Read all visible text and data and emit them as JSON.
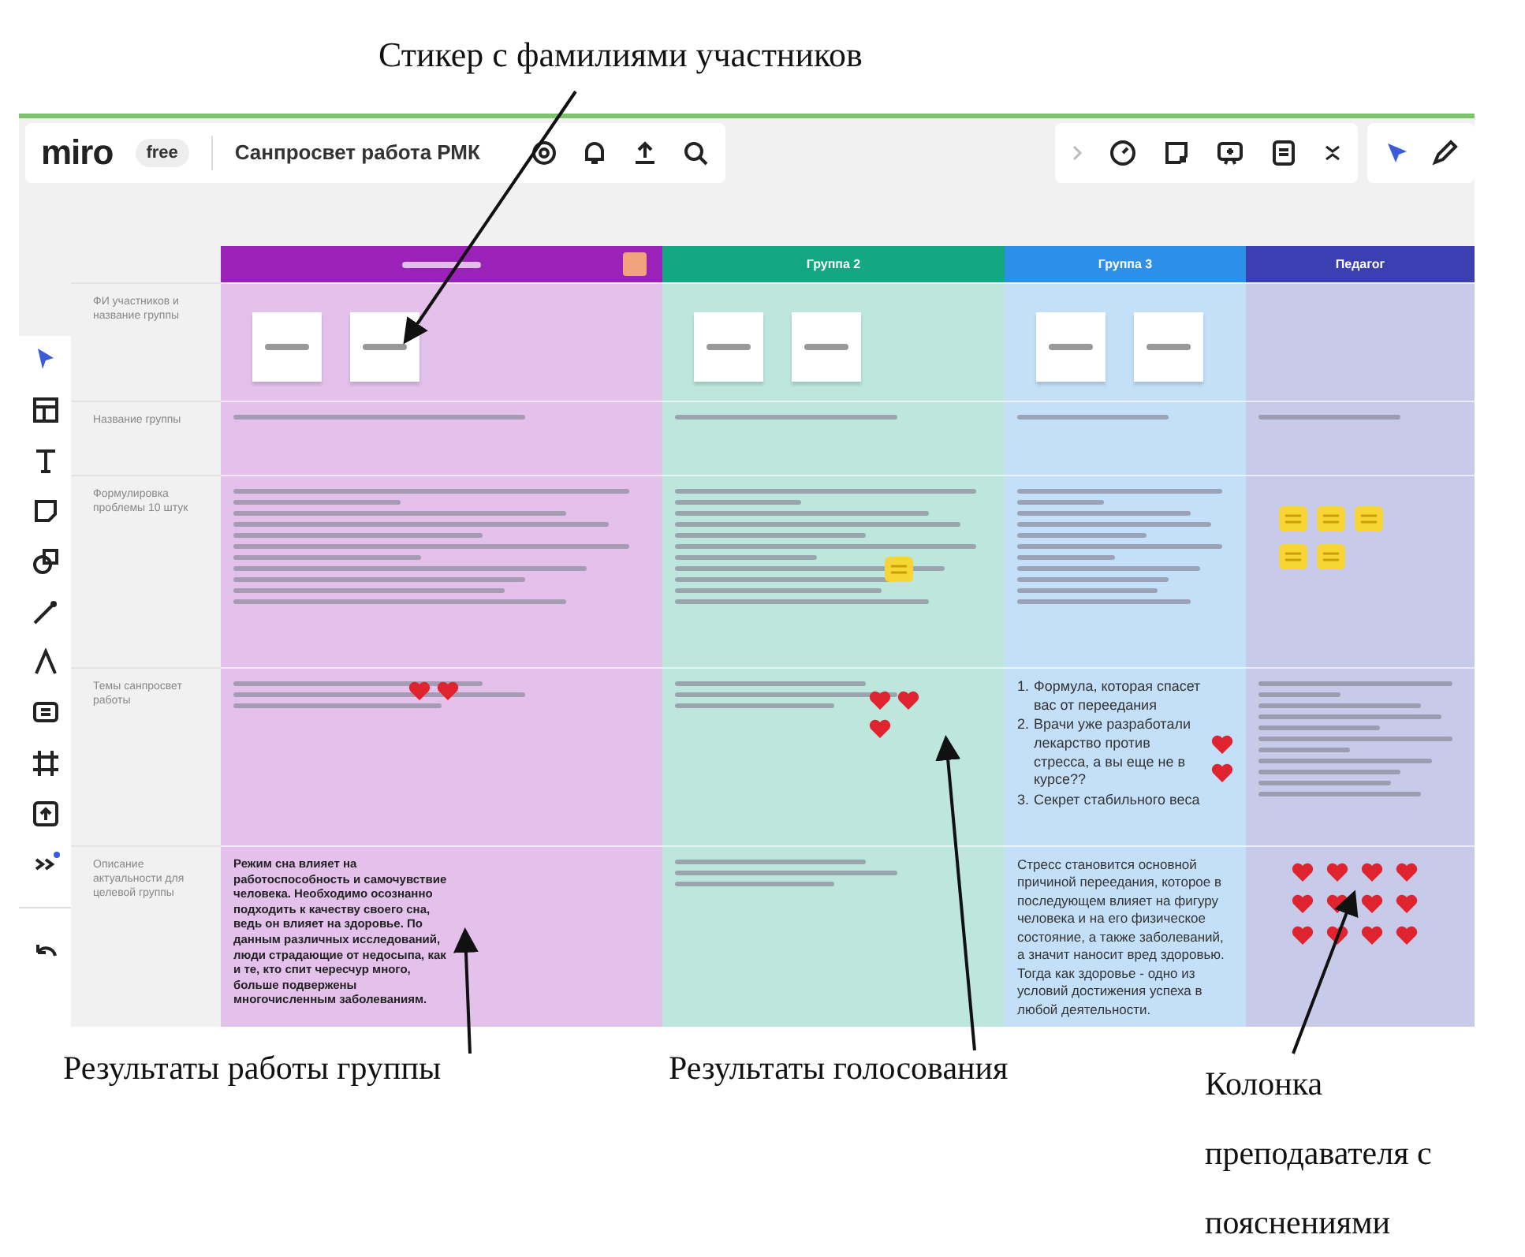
{
  "top_callout": "Стикер с фамилиями участников",
  "bottom_callouts": [
    "Результаты работы группы",
    "Результаты голосования",
    "Колонка преподавателя с пояснениями"
  ],
  "app": {
    "logo": "miro",
    "plan": "free",
    "board_title": "Санпросвет работа РМК"
  },
  "board": {
    "row_labels": [
      "ФИ участников и название группы",
      "Название группы",
      "Формулировка проблемы 10 штук",
      "Темы санпросвет работы",
      "Описание актуальности для целевой группы"
    ],
    "columns": [
      {
        "color": "#9b22b8",
        "cells": [
          {
            "kind": "stickers",
            "stickers": [
              {
                "kind": "note"
              },
              {
                "kind": "note"
              }
            ]
          },
          {
            "kind": "short"
          },
          {
            "kind": "long"
          },
          {
            "kind": "few",
            "reactions": [
              {
                "kind": "heart"
              },
              {
                "kind": "heart"
              }
            ]
          },
          {
            "kind": "paragraph",
            "text": "Режим сна влияет на работоспособность и самочувствие человека. Необходимо осознанно подходить к качеству своего сна, ведь он влияет на здоровье. По данным различных исследований, люди страдающие от недосыпа, как и те, кто спит чересчур много, больше подвержены многочисленным заболеваниям."
          }
        ]
      },
      {
        "title": "Группа 2",
        "color": "#14a882",
        "cells": [
          {
            "kind": "stickers",
            "stickers": [
              {
                "kind": "note"
              },
              {
                "kind": "note"
              }
            ]
          },
          {
            "kind": "short"
          },
          {
            "kind": "long",
            "reactions": [
              {
                "kind": "sticky"
              }
            ]
          },
          {
            "kind": "few",
            "reactions": [
              {
                "kind": "heart"
              },
              {
                "kind": "heart"
              },
              {
                "kind": "heart"
              }
            ]
          },
          {
            "kind": "few"
          }
        ]
      },
      {
        "title": "Группа 3",
        "color": "#2c8fe8",
        "cells": [
          {
            "kind": "stickers",
            "stickers": [
              {
                "kind": "note"
              },
              {
                "kind": "note"
              }
            ]
          },
          {
            "kind": "short"
          },
          {
            "kind": "long"
          },
          {
            "kind": "list",
            "items": [
              {
                "marker": "1.",
                "text": "Формула, которая спасет вас от переедания"
              },
              {
                "marker": "2.",
                "text": "Врачи уже разработали лекарство против стресса, а вы еще не в курсе??"
              },
              {
                "marker": "3.",
                "text": "Секрет стабильного веса"
              }
            ],
            "reactions": [
              {
                "kind": "heart"
              },
              {
                "kind": "heart"
              }
            ]
          },
          {
            "kind": "paragraph",
            "text": "Стресс становится основной причиной переедания, которое в последующем влияет на фигуру человека и на его физическое состояние, а также заболеваний, а значит наносит вред здоровью. Тогда как здоровье - одно из условий достижения успеха в любой деятельности."
          }
        ]
      },
      {
        "title": "Педагог",
        "color": "#3a40b2",
        "cells": [
          {
            "kind": "empty"
          },
          {
            "kind": "short"
          },
          {
            "kind": "empty",
            "reactions": [
              {
                "kind": "sticky"
              },
              {
                "kind": "sticky"
              },
              {
                "kind": "sticky"
              },
              {
                "kind": "sticky"
              },
              {
                "kind": "sticky"
              }
            ]
          },
          {
            "kind": "long"
          },
          {
            "kind": "empty",
            "reactions": [
              {
                "kind": "heart"
              },
              {
                "kind": "heart"
              },
              {
                "kind": "heart"
              },
              {
                "kind": "heart"
              },
              {
                "kind": "heart"
              },
              {
                "kind": "heart"
              },
              {
                "kind": "heart"
              },
              {
                "kind": "heart"
              },
              {
                "kind": "heart"
              },
              {
                "kind": "heart"
              },
              {
                "kind": "heart"
              },
              {
                "kind": "heart"
              }
            ]
          }
        ]
      }
    ]
  }
}
